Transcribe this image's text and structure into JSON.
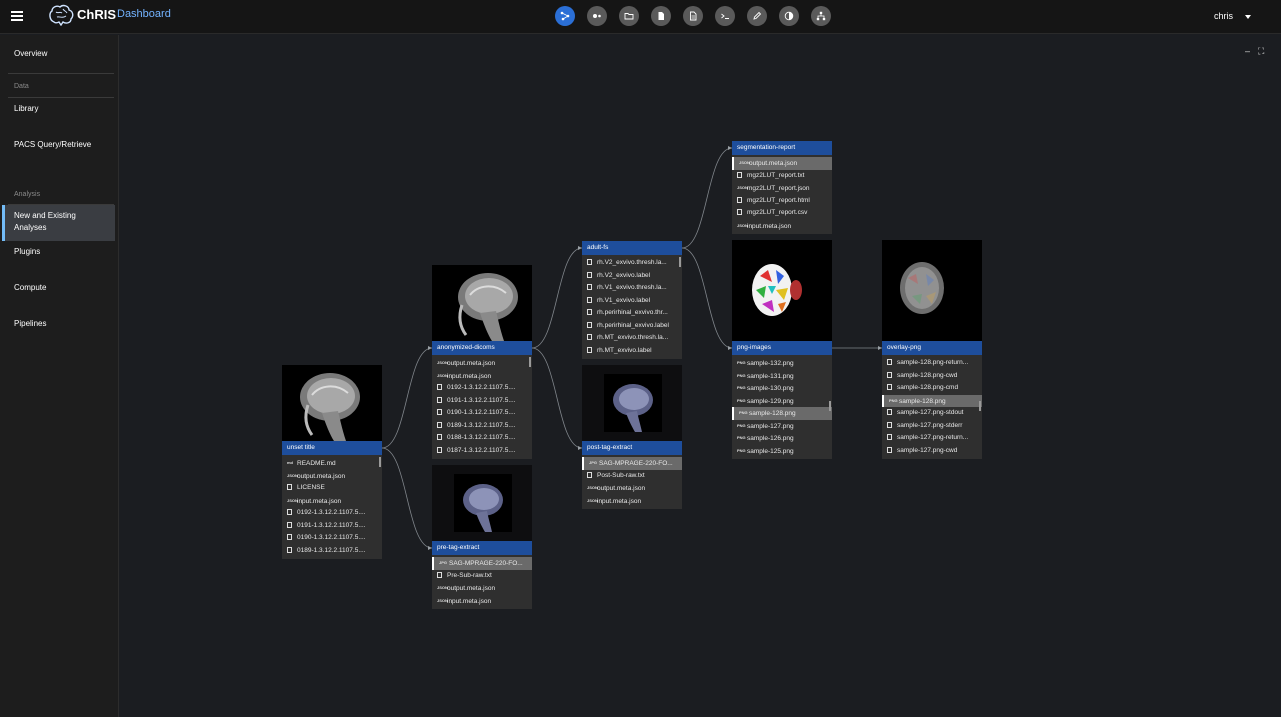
{
  "header": {
    "brand": "ChRIS",
    "brand_sub": "Dashboard",
    "user": "chris",
    "tools": [
      "graph-icon",
      "dots-icon",
      "folder-icon",
      "file-icon",
      "document-icon",
      "terminal-icon",
      "pen-icon",
      "contrast-icon",
      "tree-icon"
    ]
  },
  "sidebar": {
    "overview": "Overview",
    "data_section": "Data",
    "library": "Library",
    "pacs": "PACS Query/Retrieve",
    "analysis_section": "Analysis",
    "new_existing_1": "New and Existing",
    "new_existing_2": "Analyses",
    "plugins": "Plugins",
    "compute": "Compute",
    "pipelines": "Pipelines"
  },
  "canvas": {
    "minimize": "–",
    "expand": "⛶"
  },
  "nodes": {
    "unset": {
      "title": "unset title",
      "files": [
        {
          "icon": "md",
          "name": "README.md"
        },
        {
          "icon": "JSON",
          "name": "output.meta.json"
        },
        {
          "icon": "doc",
          "name": "LICENSE"
        },
        {
          "icon": "JSON",
          "name": "input.meta.json"
        },
        {
          "icon": "doc",
          "name": "0192-1.3.12.2.1107.5...."
        },
        {
          "icon": "doc",
          "name": "0191-1.3.12.2.1107.5...."
        },
        {
          "icon": "doc",
          "name": "0190-1.3.12.2.1107.5...."
        },
        {
          "icon": "doc",
          "name": "0189-1.3.12.2.1107.5...."
        }
      ]
    },
    "anon": {
      "title": "anonymized-dicoms",
      "files": [
        {
          "icon": "JSON",
          "name": "output.meta.json"
        },
        {
          "icon": "JSON",
          "name": "input.meta.json"
        },
        {
          "icon": "doc",
          "name": "0192-1.3.12.2.1107.5...."
        },
        {
          "icon": "doc",
          "name": "0191-1.3.12.2.1107.5...."
        },
        {
          "icon": "doc",
          "name": "0190-1.3.12.2.1107.5...."
        },
        {
          "icon": "doc",
          "name": "0189-1.3.12.2.1107.5...."
        },
        {
          "icon": "doc",
          "name": "0188-1.3.12.2.1107.5...."
        },
        {
          "icon": "doc",
          "name": "0187-1.3.12.2.1107.5...."
        }
      ]
    },
    "pretag": {
      "title": "pre-tag-extract",
      "files": [
        {
          "icon": "JPG",
          "name": "SAG-MPRAGE-220-FO..."
        },
        {
          "icon": "doc",
          "name": "Pre-Sub-raw.txt"
        },
        {
          "icon": "JSON",
          "name": "output.meta.json"
        },
        {
          "icon": "JSON",
          "name": "input.meta.json"
        }
      ]
    },
    "adultfs": {
      "title": "adult-fs",
      "files": [
        {
          "icon": "doc",
          "name": "rh.V2_exvivo.thresh.la..."
        },
        {
          "icon": "doc",
          "name": "rh.V2_exvivo.label"
        },
        {
          "icon": "doc",
          "name": "rh.V1_exvivo.thresh.la..."
        },
        {
          "icon": "doc",
          "name": "rh.V1_exvivo.label"
        },
        {
          "icon": "doc",
          "name": "rh.perirhinal_exvivo.thr..."
        },
        {
          "icon": "doc",
          "name": "rh.perirhinal_exvivo.label"
        },
        {
          "icon": "doc",
          "name": "rh.MT_exvivo.thresh.la..."
        },
        {
          "icon": "doc",
          "name": "rh.MT_exvivo.label"
        }
      ]
    },
    "posttag": {
      "title": "post-tag-extract",
      "files": [
        {
          "icon": "JPG",
          "name": "SAG-MPRAGE-220-FO..."
        },
        {
          "icon": "doc",
          "name": "Post-Sub-raw.txt"
        },
        {
          "icon": "JSON",
          "name": "output.meta.json"
        },
        {
          "icon": "JSON",
          "name": "input.meta.json"
        }
      ]
    },
    "segrep": {
      "title": "segmentation-report",
      "files": [
        {
          "icon": "JSON",
          "name": "output.meta.json"
        },
        {
          "icon": "doc",
          "name": "mgz2LUT_report.txt"
        },
        {
          "icon": "JSON",
          "name": "mgz2LUT_report.json"
        },
        {
          "icon": "doc",
          "name": "mgz2LUT_report.html"
        },
        {
          "icon": "doc",
          "name": "mgz2LUT_report.csv"
        },
        {
          "icon": "JSON",
          "name": "input.meta.json"
        }
      ]
    },
    "png": {
      "title": "png-images",
      "files": [
        {
          "icon": "PNG",
          "name": "sample-132.png"
        },
        {
          "icon": "PNG",
          "name": "sample-131.png"
        },
        {
          "icon": "PNG",
          "name": "sample-130.png"
        },
        {
          "icon": "PNG",
          "name": "sample-129.png"
        },
        {
          "icon": "PNG",
          "name": "sample-128.png"
        },
        {
          "icon": "PNG",
          "name": "sample-127.png"
        },
        {
          "icon": "PNG",
          "name": "sample-126.png"
        },
        {
          "icon": "PNG",
          "name": "sample-125.png"
        }
      ]
    },
    "overlay": {
      "title": "overlay-png",
      "files": [
        {
          "icon": "doc",
          "name": "sample-128.png-return..."
        },
        {
          "icon": "doc",
          "name": "sample-128.png-cwd"
        },
        {
          "icon": "doc",
          "name": "sample-128.png-cmd"
        },
        {
          "icon": "PNG",
          "name": "sample-128.png"
        },
        {
          "icon": "doc",
          "name": "sample-127.png-stdout"
        },
        {
          "icon": "doc",
          "name": "sample-127.png-stderr"
        },
        {
          "icon": "doc",
          "name": "sample-127.png-return..."
        },
        {
          "icon": "doc",
          "name": "sample-127.png-cwd"
        }
      ]
    }
  }
}
